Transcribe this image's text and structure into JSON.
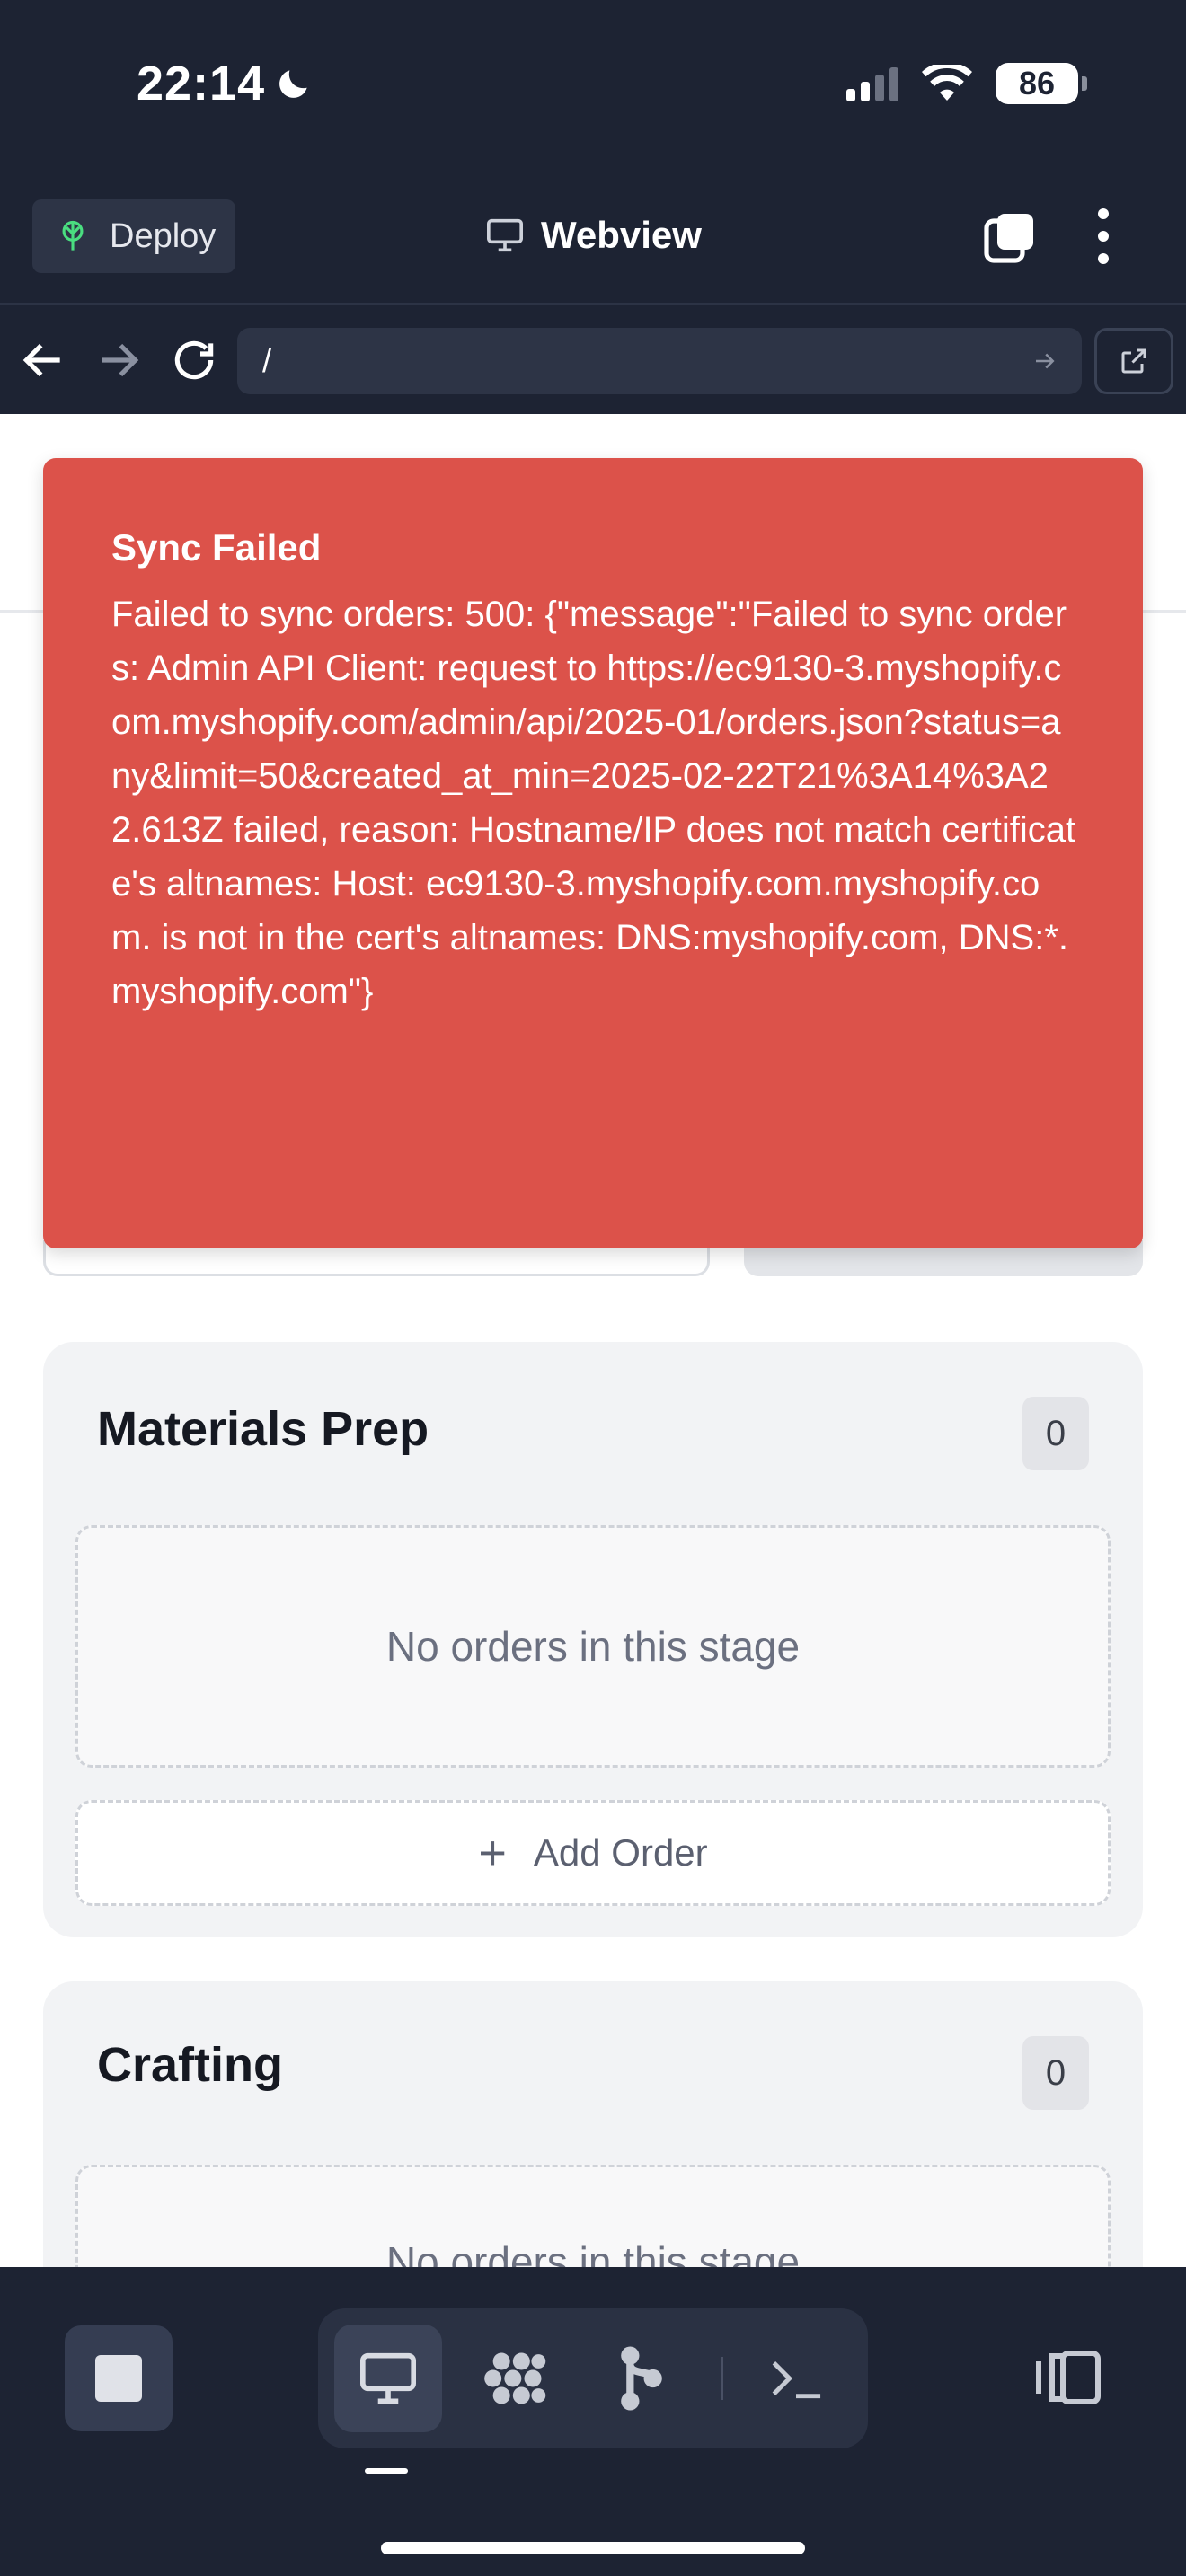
{
  "status_bar": {
    "time": "22:14",
    "battery": "86"
  },
  "header": {
    "deploy_label": "Deploy",
    "title": "Webview"
  },
  "url_bar": {
    "url": "/"
  },
  "toast": {
    "title": "Sync Failed",
    "message": "Failed to sync orders: 500: {\"message\":\"Failed to sync orders: Admin API Client: request to https://ec9130-3.myshopify.com.myshopify.com/admin/api/2025-01/orders.json?status=any&limit=50&created_at_min=2025-02-22T21%3A14%3A22.613Z failed, reason: Hostname/IP does not match certificate's altnames: Host: ec9130-3.myshopify.com.myshopify.com. is not in the cert's altnames: DNS:myshopify.com, DNS:*.myshopify.com\"}"
  },
  "stages": [
    {
      "title": "Materials Prep",
      "count": "0",
      "empty_text": "No orders in this stage",
      "add_label": "Add Order"
    },
    {
      "title": "Crafting",
      "count": "0",
      "empty_text": "No orders in this stage"
    }
  ],
  "colors": {
    "toast_bg": "#dc524a",
    "chrome_bg": "#1d2333",
    "stage_bg": "#f2f3f5"
  },
  "dock": {
    "icons": [
      "stop-icon",
      "desktop-icon",
      "workspace-icon",
      "git-branch-icon",
      "terminal-icon",
      "panel-toggle-icon"
    ]
  }
}
